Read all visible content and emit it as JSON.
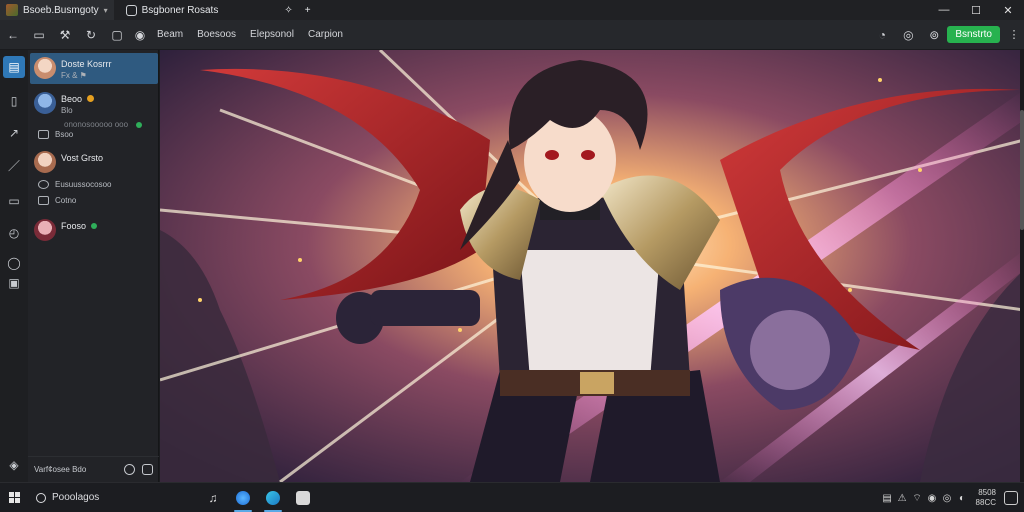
{
  "titlebar": {
    "tabs": [
      {
        "label": "Bsoeb.Busmgoty",
        "active": true
      },
      {
        "label": "Bsgboner Rosats",
        "active": false
      }
    ],
    "new_tab": "+",
    "controls": {
      "minimize": "—",
      "maximize": "☐",
      "close": "✕"
    }
  },
  "toolbar": {
    "links": [
      "Beam",
      "Boesoos",
      "Elepsonol",
      "Carpion"
    ],
    "primary_button": "Bsnstrto",
    "menu": "⋮"
  },
  "rail": {
    "icons": [
      "back-icon",
      "chat-icon",
      "bookmark-icon",
      "share-icon",
      "edit-icon",
      "layout-icon",
      "timer-icon",
      "eye-icon",
      "frame-icon",
      "help-icon"
    ]
  },
  "sidebar": {
    "conversations": [
      {
        "title": "Doste Kosrrr",
        "subtitle": "Fx  &  ⚑",
        "selected": true
      },
      {
        "title": "Beoo",
        "subtitle": "Blo",
        "selected": false
      },
      {
        "title": "Vost Grsto",
        "subtitle": "",
        "selected": false
      },
      {
        "title": "Fooso",
        "subtitle": "",
        "selected": false
      }
    ],
    "sub_items": [
      {
        "label": "Bsoo"
      },
      {
        "label": "Eusuussocosoo"
      },
      {
        "label": "Cotno"
      }
    ],
    "dim_line": "ononosooooo ooo",
    "footer_label": "Varf¢osee Bdo"
  },
  "taskbar": {
    "search_label": "Pooolagos",
    "clock_time": "8508",
    "clock_date": "88CC"
  },
  "colors": {
    "accent_blue": "#2f78b7",
    "primary_green": "#27b24f",
    "status_green": "#2fae5a"
  }
}
